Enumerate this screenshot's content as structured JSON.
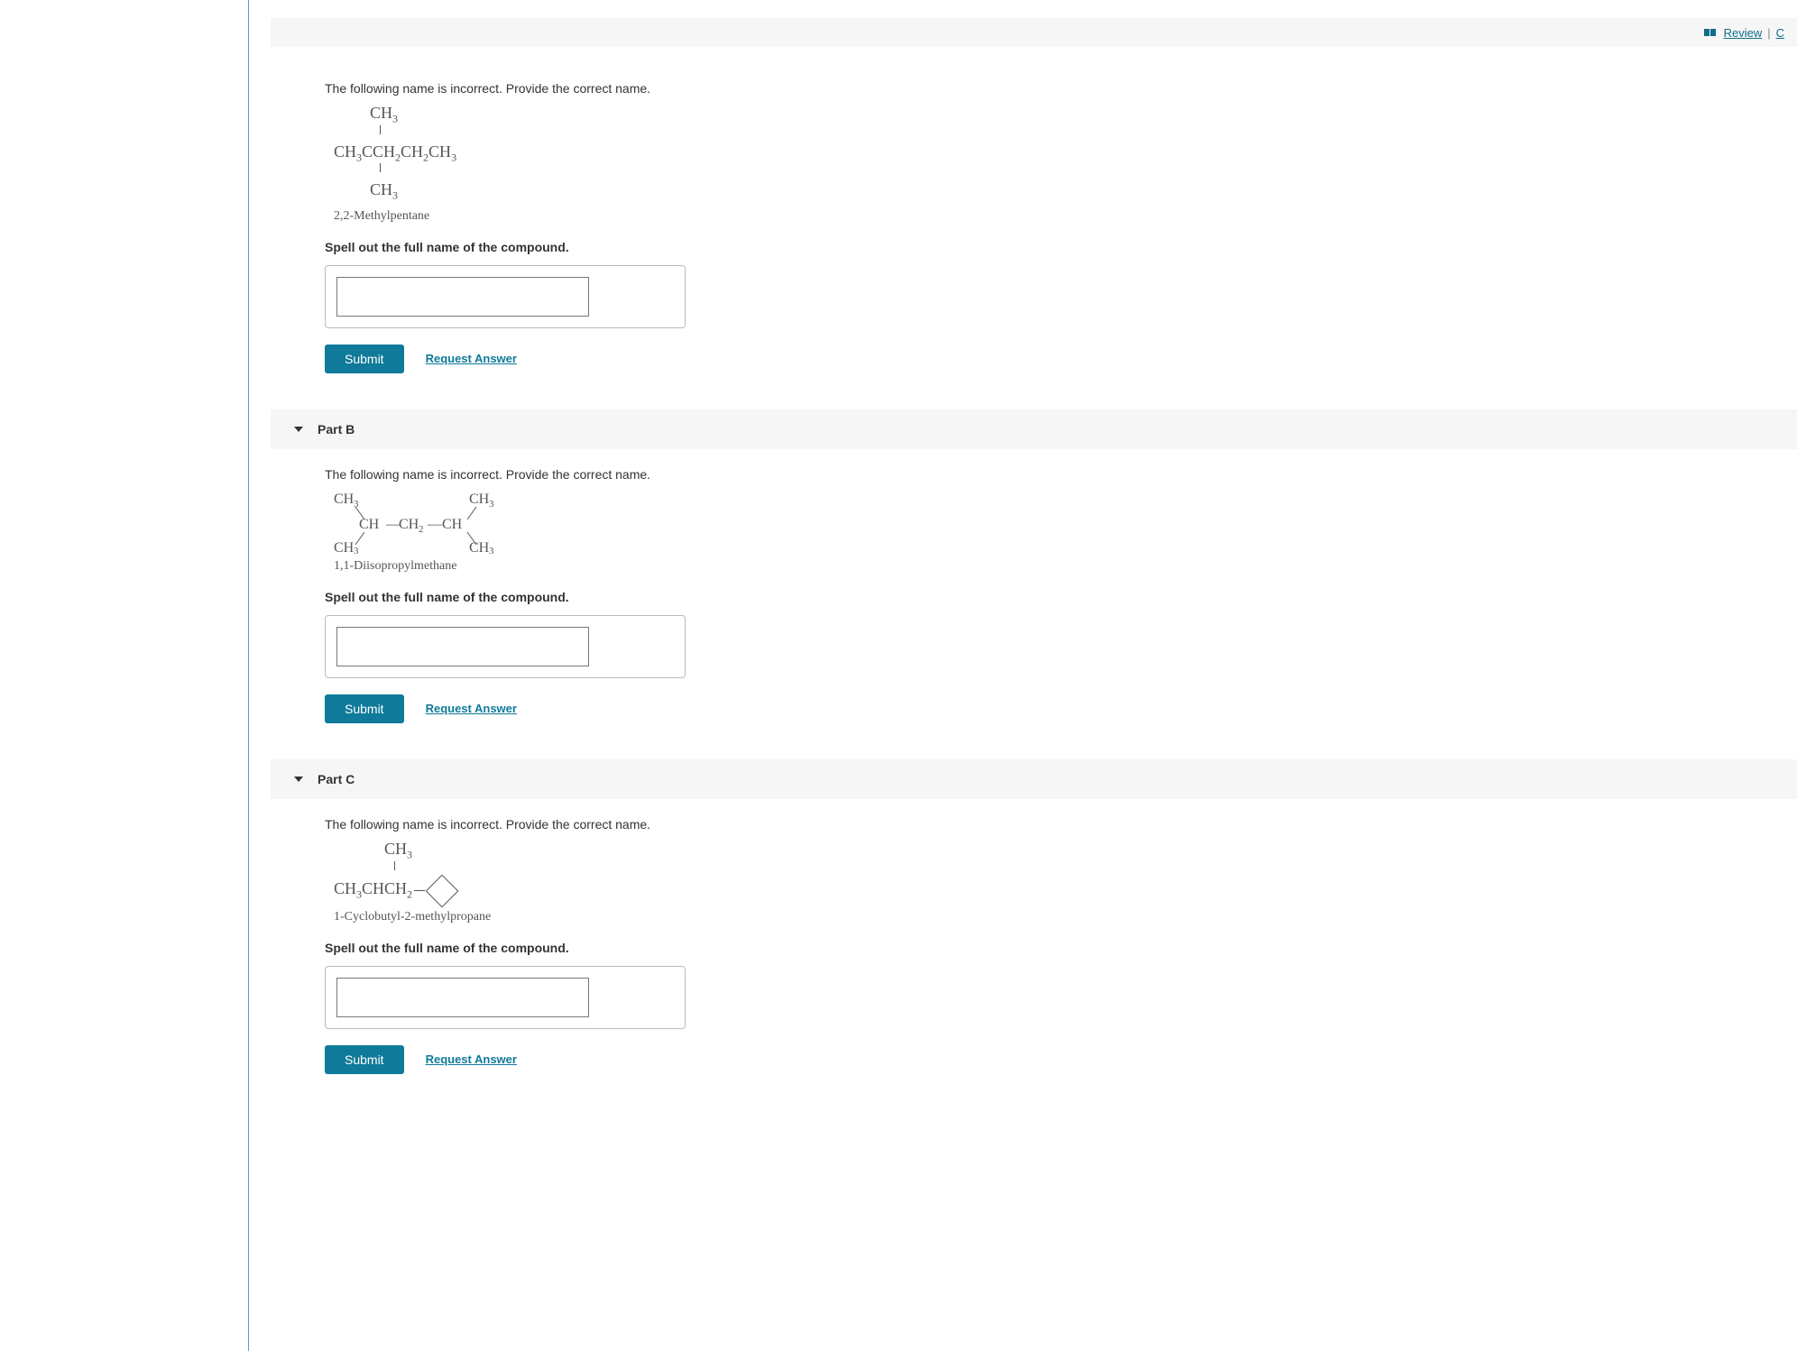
{
  "toolbar": {
    "review": "Review",
    "divider": "|",
    "next": "C"
  },
  "partA": {
    "prompt": "The following name is incorrect. Provide the correct name.",
    "formula_top": "CH",
    "formula_main_1": "CH",
    "formula_main_2": "CCH",
    "formula_main_3": "CH",
    "formula_main_4": "CH",
    "formula_bot": "CH",
    "sub3": "3",
    "sub2": "2",
    "caption": "2,2-Methylpentane",
    "instruction": "Spell out the full name of the compound.",
    "submit": "Submit",
    "request": "Request Answer"
  },
  "partB": {
    "header": "Part B",
    "prompt": "The following name is incorrect. Provide the correct name.",
    "caption": "1,1-Diisopropylmethane",
    "instruction": "Spell out the full name of the compound.",
    "submit": "Submit",
    "request": "Request Answer"
  },
  "partC": {
    "header": "Part C",
    "prompt": "The following name is incorrect. Provide the correct name.",
    "formula_top": "CH",
    "formula_main_1": "CH",
    "formula_main_2": "CHCH",
    "sub3": "3",
    "sub2": "2",
    "caption": "1-Cyclobutyl-2-methylpropane",
    "instruction": "Spell out the full name of the compound.",
    "submit": "Submit",
    "request": "Request Answer"
  }
}
